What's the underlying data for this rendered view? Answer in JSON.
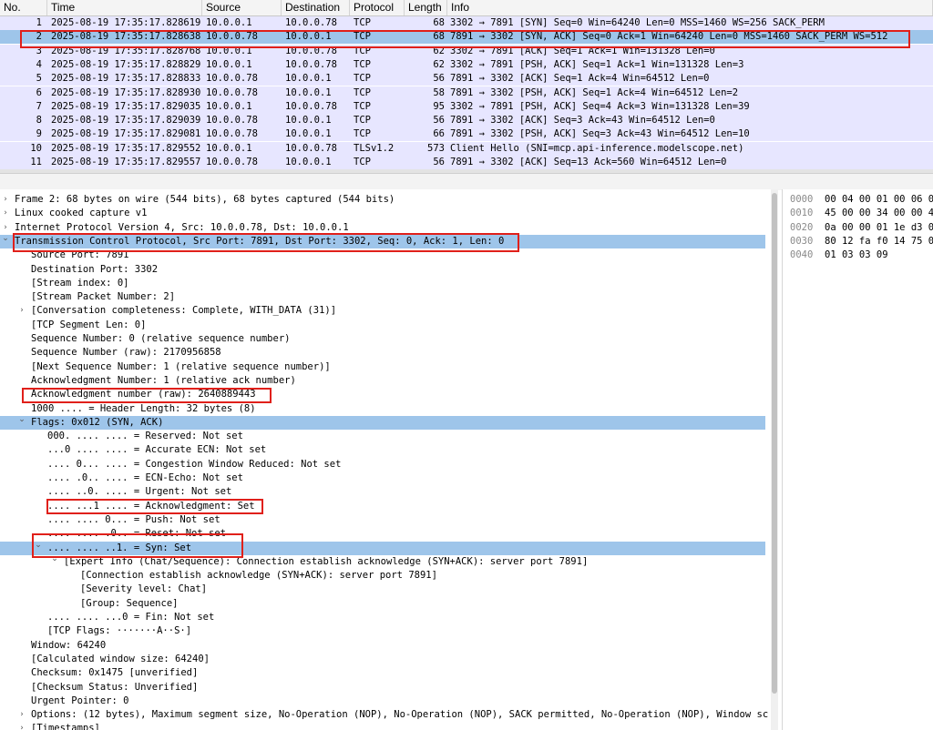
{
  "packet_list": {
    "columns": [
      "No.",
      "Time",
      "Source",
      "Destination",
      "Protocol",
      "Length",
      "Info"
    ],
    "rows": [
      {
        "no": "1",
        "time": "2025-08-19 17:35:17.828619",
        "src": "10.0.0.1",
        "dst": "10.0.0.78",
        "proto": "TCP",
        "len": "68",
        "info": "3302 → 7891 [SYN] Seq=0 Win=64240 Len=0 MSS=1460 WS=256 SACK_PERM"
      },
      {
        "no": "2",
        "time": "2025-08-19 17:35:17.828638",
        "src": "10.0.0.78",
        "dst": "10.0.0.1",
        "proto": "TCP",
        "len": "68",
        "info": "7891 → 3302 [SYN, ACK] Seq=0 Ack=1 Win=64240 Len=0 MSS=1460 SACK_PERM WS=512"
      },
      {
        "no": "3",
        "time": "2025-08-19 17:35:17.828768",
        "src": "10.0.0.1",
        "dst": "10.0.0.78",
        "proto": "TCP",
        "len": "62",
        "info": "3302 → 7891 [ACK] Seq=1 Ack=1 Win=131328 Len=0"
      },
      {
        "no": "4",
        "time": "2025-08-19 17:35:17.828829",
        "src": "10.0.0.1",
        "dst": "10.0.0.78",
        "proto": "TCP",
        "len": "62",
        "info": "3302 → 7891 [PSH, ACK] Seq=1 Ack=1 Win=131328 Len=3"
      },
      {
        "no": "5",
        "time": "2025-08-19 17:35:17.828833",
        "src": "10.0.0.78",
        "dst": "10.0.0.1",
        "proto": "TCP",
        "len": "56",
        "info": "7891 → 3302 [ACK] Seq=1 Ack=4 Win=64512 Len=0"
      },
      {
        "no": "6",
        "time": "2025-08-19 17:35:17.828930",
        "src": "10.0.0.78",
        "dst": "10.0.0.1",
        "proto": "TCP",
        "len": "58",
        "info": "7891 → 3302 [PSH, ACK] Seq=1 Ack=4 Win=64512 Len=2"
      },
      {
        "no": "7",
        "time": "2025-08-19 17:35:17.829035",
        "src": "10.0.0.1",
        "dst": "10.0.0.78",
        "proto": "TCP",
        "len": "95",
        "info": "3302 → 7891 [PSH, ACK] Seq=4 Ack=3 Win=131328 Len=39"
      },
      {
        "no": "8",
        "time": "2025-08-19 17:35:17.829039",
        "src": "10.0.0.78",
        "dst": "10.0.0.1",
        "proto": "TCP",
        "len": "56",
        "info": "7891 → 3302 [ACK] Seq=3 Ack=43 Win=64512 Len=0"
      },
      {
        "no": "9",
        "time": "2025-08-19 17:35:17.829081",
        "src": "10.0.0.78",
        "dst": "10.0.0.1",
        "proto": "TCP",
        "len": "66",
        "info": "7891 → 3302 [PSH, ACK] Seq=3 Ack=43 Win=64512 Len=10"
      },
      {
        "no": "10",
        "time": "2025-08-19 17:35:17.829552",
        "src": "10.0.0.1",
        "dst": "10.0.0.78",
        "proto": "TLSv1.2",
        "len": "573",
        "info": "Client Hello (SNI=mcp.api-inference.modelscope.net)"
      },
      {
        "no": "11",
        "time": "2025-08-19 17:35:17.829557",
        "src": "10.0.0.78",
        "dst": "10.0.0.1",
        "proto": "TCP",
        "len": "56",
        "info": "7891 → 3302 [ACK] Seq=13 Ack=560 Win=64512 Len=0"
      }
    ]
  },
  "details": [
    {
      "indent": 0,
      "arrow": "collapsed",
      "text": "Frame 2: 68 bytes on wire (544 bits), 68 bytes captured (544 bits)"
    },
    {
      "indent": 0,
      "arrow": "collapsed",
      "text": "Linux cooked capture v1"
    },
    {
      "indent": 0,
      "arrow": "collapsed",
      "text": "Internet Protocol Version 4, Src: 10.0.0.78, Dst: 10.0.0.1"
    },
    {
      "indent": 0,
      "arrow": "expanded",
      "text": "Transmission Control Protocol, Src Port: 7891, Dst Port: 3302, Seq: 0, Ack: 1, Len: 0",
      "selected": true
    },
    {
      "indent": 1,
      "arrow": "",
      "text": "Source Port: 7891"
    },
    {
      "indent": 1,
      "arrow": "",
      "text": "Destination Port: 3302"
    },
    {
      "indent": 1,
      "arrow": "",
      "text": "[Stream index: 0]"
    },
    {
      "indent": 1,
      "arrow": "",
      "text": "[Stream Packet Number: 2]"
    },
    {
      "indent": 1,
      "arrow": "collapsed",
      "text": "[Conversation completeness: Complete, WITH_DATA (31)]"
    },
    {
      "indent": 1,
      "arrow": "",
      "text": "[TCP Segment Len: 0]"
    },
    {
      "indent": 1,
      "arrow": "",
      "text": "Sequence Number: 0    (relative sequence number)"
    },
    {
      "indent": 1,
      "arrow": "",
      "text": "Sequence Number (raw): 2170956858"
    },
    {
      "indent": 1,
      "arrow": "",
      "text": "[Next Sequence Number: 1    (relative sequence number)]"
    },
    {
      "indent": 1,
      "arrow": "",
      "text": "Acknowledgment Number: 1    (relative ack number)"
    },
    {
      "indent": 1,
      "arrow": "",
      "text": "Acknowledgment number (raw): 2640889443"
    },
    {
      "indent": 1,
      "arrow": "",
      "text": "1000 .... = Header Length: 32 bytes (8)"
    },
    {
      "indent": 1,
      "arrow": "expanded",
      "text": "Flags: 0x012 (SYN, ACK)",
      "selected": true
    },
    {
      "indent": 2,
      "arrow": "",
      "text": "000. .... .... = Reserved: Not set"
    },
    {
      "indent": 2,
      "arrow": "",
      "text": "...0 .... .... = Accurate ECN: Not set"
    },
    {
      "indent": 2,
      "arrow": "",
      "text": ".... 0... .... = Congestion Window Reduced: Not set"
    },
    {
      "indent": 2,
      "arrow": "",
      "text": ".... .0.. .... = ECN-Echo: Not set"
    },
    {
      "indent": 2,
      "arrow": "",
      "text": ".... ..0. .... = Urgent: Not set"
    },
    {
      "indent": 2,
      "arrow": "",
      "text": ".... ...1 .... = Acknowledgment: Set"
    },
    {
      "indent": 2,
      "arrow": "",
      "text": ".... .... 0... = Push: Not set"
    },
    {
      "indent": 2,
      "arrow": "",
      "text": ".... .... .0.. = Reset: Not set"
    },
    {
      "indent": 2,
      "arrow": "expanded",
      "text": ".... .... ..1. = Syn: Set",
      "selected": true
    },
    {
      "indent": 3,
      "arrow": "expanded",
      "text": "[Expert Info (Chat/Sequence): Connection establish acknowledge (SYN+ACK): server port 7891]"
    },
    {
      "indent": 4,
      "arrow": "",
      "text": "[Connection establish acknowledge (SYN+ACK): server port 7891]"
    },
    {
      "indent": 4,
      "arrow": "",
      "text": "[Severity level: Chat]"
    },
    {
      "indent": 4,
      "arrow": "",
      "text": "[Group: Sequence]"
    },
    {
      "indent": 2,
      "arrow": "",
      "text": ".... .... ...0 = Fin: Not set"
    },
    {
      "indent": 2,
      "arrow": "",
      "text": "[TCP Flags: ·······A··S·]"
    },
    {
      "indent": 1,
      "arrow": "",
      "text": "Window: 64240"
    },
    {
      "indent": 1,
      "arrow": "",
      "text": "[Calculated window size: 64240]"
    },
    {
      "indent": 1,
      "arrow": "",
      "text": "Checksum: 0x1475 [unverified]"
    },
    {
      "indent": 1,
      "arrow": "",
      "text": "[Checksum Status: Unverified]"
    },
    {
      "indent": 1,
      "arrow": "",
      "text": "Urgent Pointer: 0"
    },
    {
      "indent": 1,
      "arrow": "collapsed",
      "text": "Options: (12 bytes), Maximum segment size, No-Operation (NOP), No-Operation (NOP), SACK permitted, No-Operation (NOP), Window sc"
    },
    {
      "indent": 1,
      "arrow": "collapsed",
      "text": "[Timestamps]"
    }
  ],
  "hex": [
    {
      "offset": "0000",
      "bytes": "00 04 00 01 00 06 0"
    },
    {
      "offset": "0010",
      "bytes": "45 00 00 34 00 00 4"
    },
    {
      "offset": "0020",
      "bytes": "0a 00 00 01 1e d3 0"
    },
    {
      "offset": "0030",
      "bytes": "80 12 fa f0 14 75 0"
    },
    {
      "offset": "0040",
      "bytes": "01 03 03 09"
    }
  ],
  "colors": {
    "row_tcp_bg": "#e7e6ff",
    "selected_bg": "#9ec5ea",
    "highlight_box": "#e0201a"
  }
}
